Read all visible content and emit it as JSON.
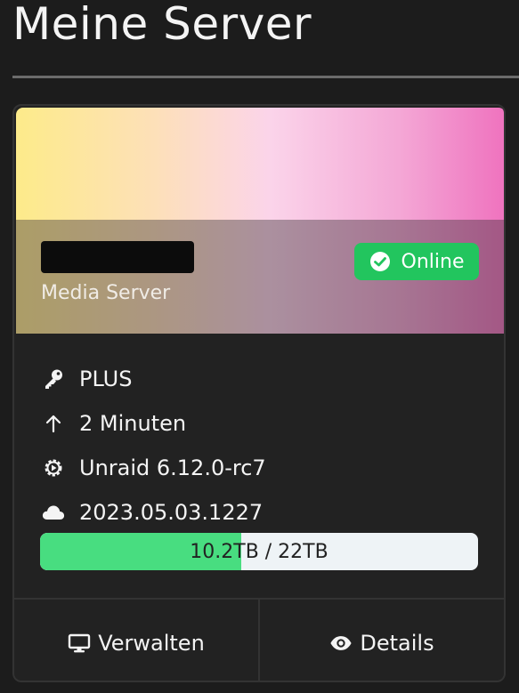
{
  "page": {
    "title": "Meine Server"
  },
  "server": {
    "name": "",
    "description": "Media Server",
    "status": "Online",
    "colors": {
      "status_bg": "#22c55e",
      "banner_gradient": [
        "#fdeb8a",
        "#fbd4ea",
        "#ef72be"
      ]
    }
  },
  "info": {
    "license": "PLUS",
    "uptime": "2 Minuten",
    "os_version": "Unraid 6.12.0-rc7",
    "connect_version": "2023.05.03.1227"
  },
  "storage": {
    "used": "10.2TB",
    "total": "22TB",
    "label": "10.2TB / 22TB",
    "fraction": 0.46
  },
  "actions": {
    "manage_label": "Verwalten",
    "details_label": "Details"
  },
  "icons": [
    "key-icon",
    "arrow-up-icon",
    "gear-icon",
    "cloud-icon",
    "check-circle-icon",
    "monitor-icon",
    "eye-icon"
  ]
}
